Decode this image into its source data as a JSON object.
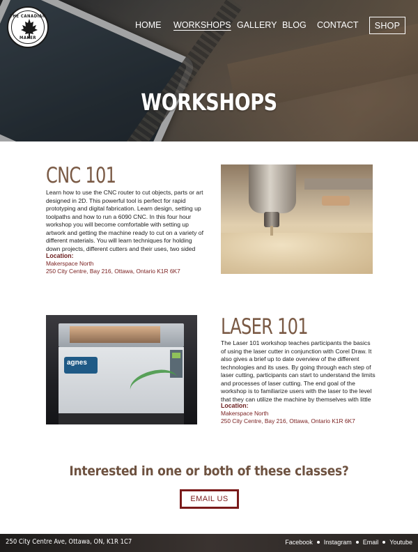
{
  "logo": {
    "top_text": "THE CANADIAN",
    "bottom_text": "MAKER",
    "icon": "maple-leaf-icon"
  },
  "nav": {
    "items": [
      "HOME",
      "WORKSHOPS",
      "GALLERY",
      "BLOG",
      "CONTACT"
    ],
    "active": "WORKSHOPS",
    "shop_label": "SHOP"
  },
  "hero": {
    "title": "WORKSHOPS"
  },
  "workshops": [
    {
      "title": "CNC 101",
      "description": "Learn how to use the CNC router to cut objects, parts or art designed in 2D. This powerful tool is perfect for rapid prototyping and digital fabrication. Learn design, setting up toolpaths and how to run a 6090 CNC. In this four hour workshop you will become comfortable with setting up artwork and getting the machine ready to cut on a variety of different materials. You will learn techniques for holding down projects, different cutters and their uses, two sided machining and much,",
      "location_label": "Location:",
      "location_name": "Makerspace North",
      "location_address": "250 City Centre, Bay 216, Ottawa, Ontario K1R 6K7"
    },
    {
      "title": "LASER 101",
      "description": "The Laser 101 workshop teaches participants the basics of using the laser cutter in conjunction with Corel Draw. It also gives a brief up to date overview of the different technologies and its uses. By going through each step of laser cutting, participants can start to understand the limits and processes of laser cutting. The end goal of the workshop is to familiarize users with the laser to the level that they can utilize the machine by themselves with little to no assistance.",
      "location_label": "Location:",
      "location_name": "Makerspace North",
      "location_address": "250 City Centre, Bay 216, Ottawa, Ontario K1R 6K7",
      "photo_badge": "agnes"
    }
  ],
  "cta": {
    "question": "Interested in one or both of these classes?",
    "button_label": "EMAIL US"
  },
  "footer": {
    "address": "250 City Centre Ave, Ottawa, ON, K1R 1C7",
    "links": [
      "Facebook",
      "Instagram",
      "Email",
      "Youtube"
    ]
  },
  "colors": {
    "title_brown": "#7a5a45",
    "location_red": "#6b1d1d",
    "button_red": "#7a1a1a"
  }
}
